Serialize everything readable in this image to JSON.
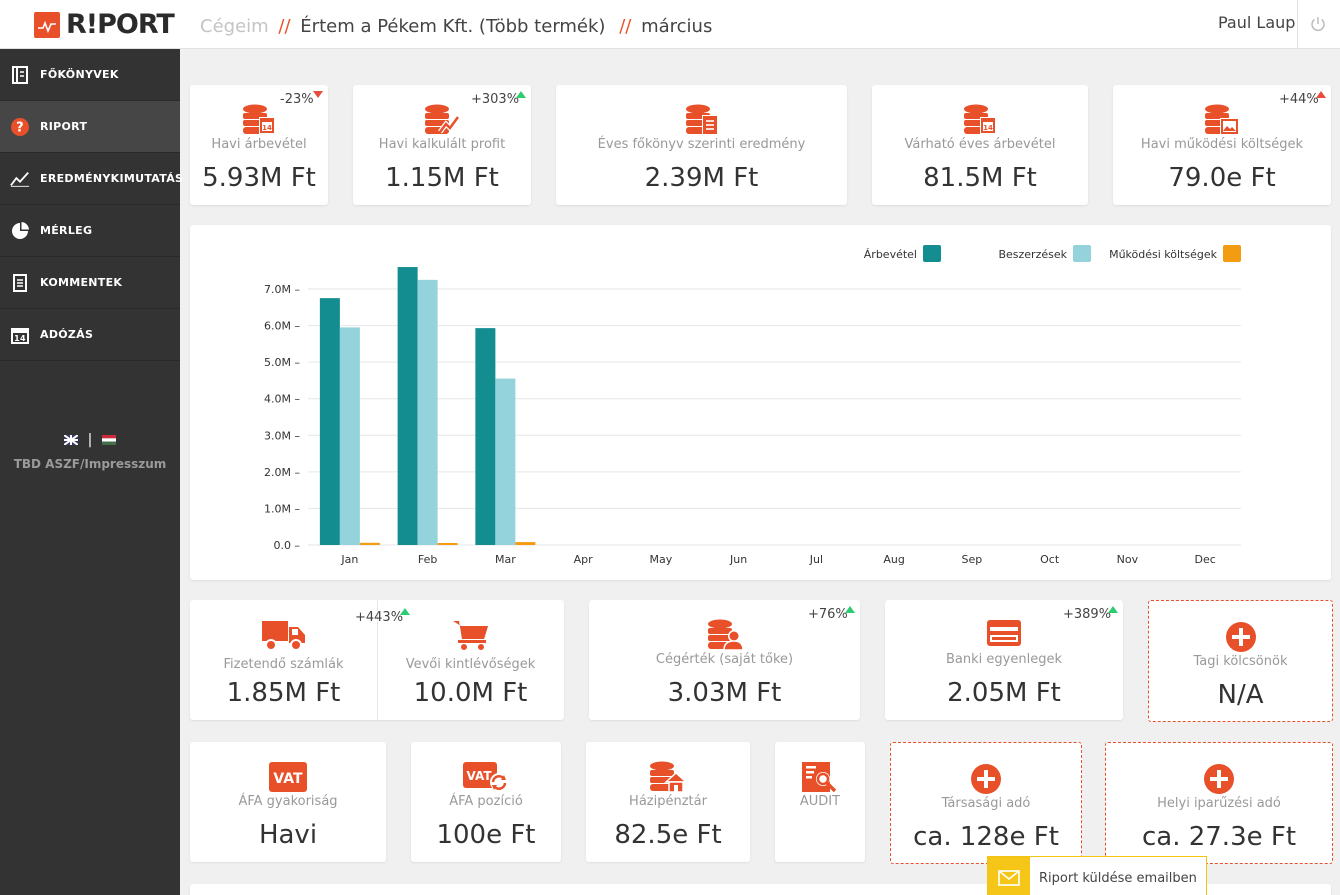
{
  "header": {
    "logo_text": "R!PORT",
    "breadcrumb_root": "Cégeim",
    "breadcrumb_sep": "//",
    "company": "Értem a Pékem Kft. (Több termék)",
    "month": "március",
    "user": "Paul Laup"
  },
  "sidebar": {
    "items": [
      {
        "label": "FŐKÖNYVEK",
        "icon": "book-icon"
      },
      {
        "label": "RIPORT",
        "icon": "question-icon"
      },
      {
        "label": "EREDMÉNYKIMUTATÁS",
        "icon": "trend-icon"
      },
      {
        "label": "MÉRLEG",
        "icon": "pie-icon"
      },
      {
        "label": "KOMMENTEK",
        "icon": "document-icon"
      },
      {
        "label": "ADÓZÁS",
        "icon": "calendar-icon"
      }
    ],
    "lang_sep": "|",
    "imprint": "TBD ASZF/Impresszum"
  },
  "kpis_top": [
    {
      "label": "Havi árbevétel",
      "value": "5.93M Ft",
      "change": "-23%",
      "direction": "down"
    },
    {
      "label": "Havi kalkulált profit",
      "value": "1.15M Ft",
      "change": "+303%",
      "direction": "up"
    },
    {
      "label": "Éves főkönyv szerinti eredmény",
      "value": "2.39M Ft"
    },
    {
      "label": "Várható éves árbevétel",
      "value": "81.5M Ft"
    },
    {
      "label": "Havi működési költségek",
      "value": "79.0e Ft",
      "change": "+44%",
      "direction": "up-bad"
    }
  ],
  "kpis_mid": [
    {
      "label": "Fizetendő számlák",
      "value": "1.85M Ft",
      "change": "+443%"
    },
    {
      "label": "Vevői kintlévőségek",
      "value": "10.0M Ft"
    },
    {
      "label": "Cégérték (saját tőke)",
      "value": "3.03M Ft",
      "change": "+76%"
    },
    {
      "label": "Banki egyenlegek",
      "value": "2.05M Ft",
      "change": "+389%"
    },
    {
      "label": "Tagi kölcsönök",
      "value": "N/A"
    }
  ],
  "kpis_bottom": [
    {
      "label": "ÁFA gyakoriság",
      "value": "Havi",
      "icon_text": "VAT"
    },
    {
      "label": "ÁFA pozíció",
      "value": "100e Ft",
      "icon_text": "VAT"
    },
    {
      "label": "Házipénztár",
      "value": "82.5e Ft"
    },
    {
      "label": "AUDIT",
      "value": ""
    },
    {
      "label": "Társasági adó",
      "value": "ca. 128e Ft"
    },
    {
      "label": "Helyi iparűzési adó",
      "value": "ca. 27.3e Ft"
    }
  ],
  "email_button": "Riport küldése emailben",
  "colors": {
    "accent": "#e8502a",
    "sidebar": "#333333",
    "revenue": "#138d90",
    "purchases": "#94d3dc",
    "opex": "#f39c12"
  },
  "chart_data": {
    "type": "bar",
    "categories": [
      "Jan",
      "Feb",
      "Mar",
      "Apr",
      "May",
      "Jun",
      "Jul",
      "Aug",
      "Sep",
      "Oct",
      "Nov",
      "Dec"
    ],
    "series": [
      {
        "name": "Árbevétel",
        "color": "#138d90",
        "values": [
          6.75,
          7.6,
          5.93,
          0,
          0,
          0,
          0,
          0,
          0,
          0,
          0,
          0
        ]
      },
      {
        "name": "Beszerzések",
        "color": "#94d3dc",
        "values": [
          5.95,
          7.25,
          4.55,
          0,
          0,
          0,
          0,
          0,
          0,
          0,
          0,
          0
        ]
      },
      {
        "name": "Működési költségek",
        "color": "#f39c12",
        "values": [
          0.06,
          0.05,
          0.08,
          0,
          0,
          0,
          0,
          0,
          0,
          0,
          0,
          0
        ]
      }
    ],
    "y_ticks": [
      "0.0",
      "1.0M",
      "2.0M",
      "3.0M",
      "4.0M",
      "5.0M",
      "6.0M",
      "7.0M"
    ],
    "ylim": [
      0,
      7
    ],
    "unit": "M",
    "grid": true,
    "legend": "top-right"
  }
}
